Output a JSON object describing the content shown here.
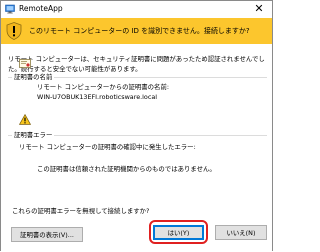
{
  "window": {
    "title": "RemoteApp",
    "close_glyph": "✕"
  },
  "banner": {
    "message": "このリモート コンピューターの ID を識別できません。接続しますか?",
    "accent_color": "#fcc62d"
  },
  "intro": {
    "text": "リモート コンピューターは、セキュリティ証明書に問題があったため認証されませんでした。続行すると安全でない可能性があります。"
  },
  "certificate_name": {
    "section_label": "証明書の名前",
    "caption": "リモート コンピューターからの証明書の名前:",
    "value": "WIN-U7OBUK13EFI.roboticsware.local"
  },
  "certificate_errors": {
    "section_label": "証明書エラー",
    "caption": "リモート コンピューターの証明書の確認中に発生したエラー:",
    "error_text": "この証明書は信頼された証明機関からのものではありません。"
  },
  "question": {
    "text": "これらの証明書エラーを無視して接続しますか?"
  },
  "buttons": {
    "view_certificate": "証明書の表示(V)...",
    "yes": "はい(Y)",
    "no": "いいえ(N)"
  },
  "icons": {
    "app": "remoteapp-icon",
    "shield": "security-warning-shield-icon",
    "certificate": "certificate-icon",
    "warning": "warning-icon"
  }
}
